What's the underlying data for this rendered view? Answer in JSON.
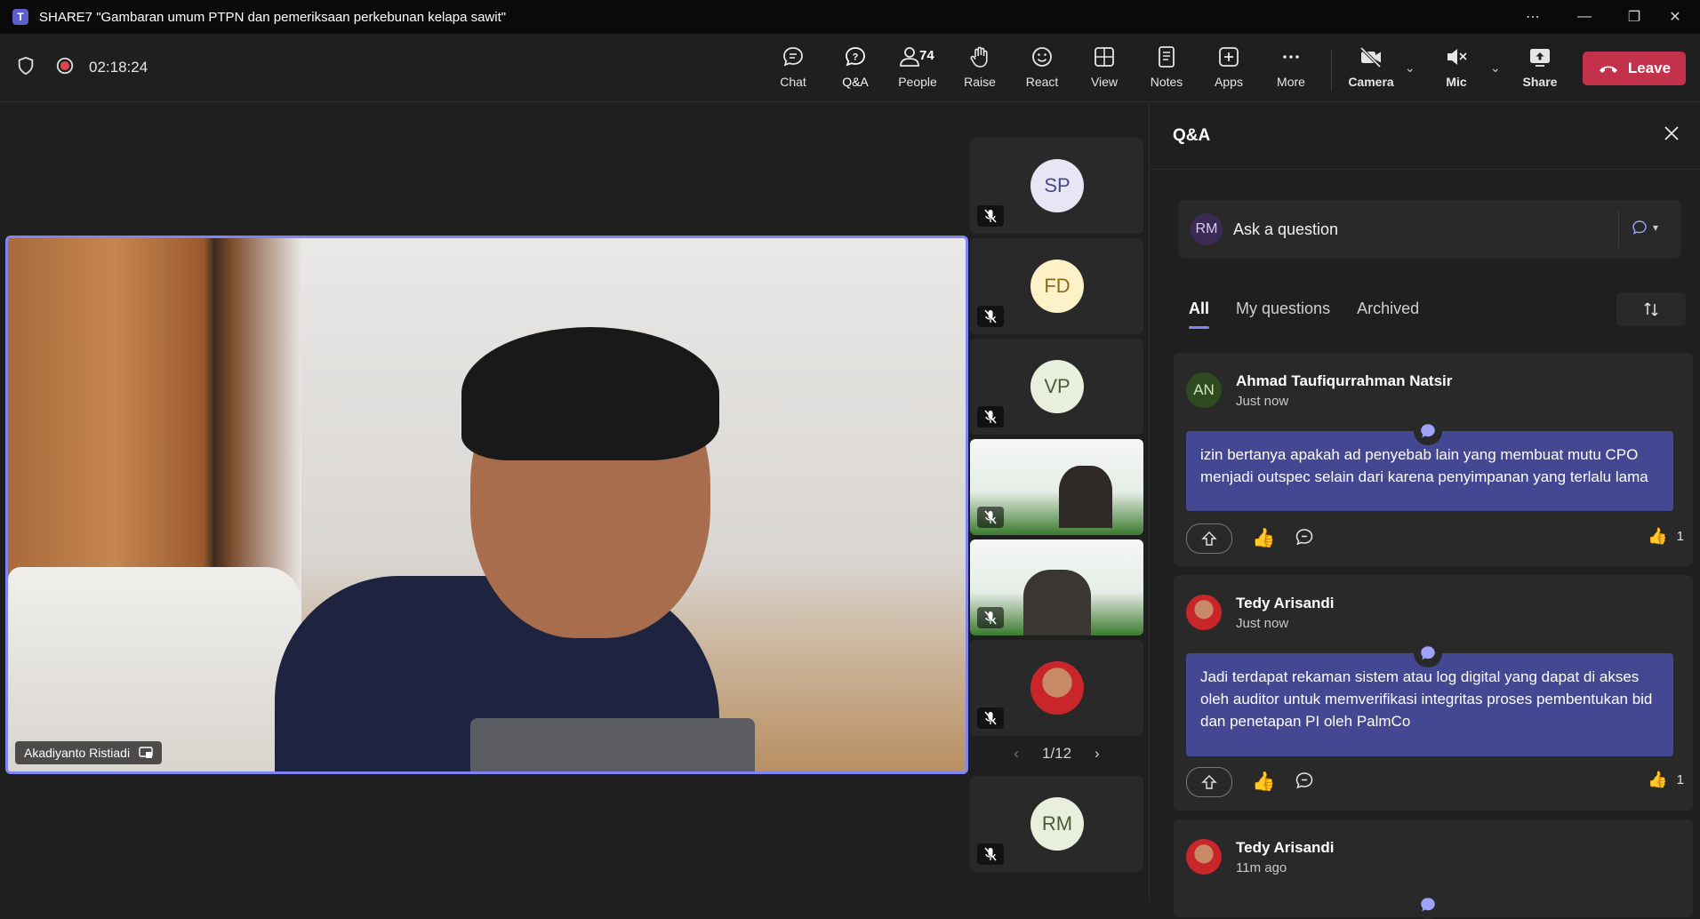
{
  "window": {
    "title": "SHARE7 \"Gambaran umum PTPN dan pemeriksaan perkebunan kelapa sawit\""
  },
  "toolbar": {
    "timer": "02:18:24",
    "people_count": "74",
    "buttons": {
      "chat": "Chat",
      "qa": "Q&A",
      "people": "People",
      "raise": "Raise",
      "react": "React",
      "view": "View",
      "notes": "Notes",
      "apps": "Apps",
      "more": "More",
      "camera": "Camera",
      "mic": "Mic",
      "share": "Share"
    },
    "leave": "Leave"
  },
  "stage": {
    "main_speaker": "Akadiyanto Ristiadi",
    "tiles": [
      {
        "initials": "SP",
        "color": "#e8e6f5"
      },
      {
        "initials": "FD",
        "color": "#fdf1c7"
      },
      {
        "initials": "VP",
        "color": "#e9efdd"
      },
      {
        "initials": "",
        "type": "share"
      },
      {
        "initials": "",
        "type": "share"
      },
      {
        "initials": "",
        "type": "photo"
      }
    ],
    "pager": "1/12",
    "bottom_tile": {
      "initials": "RM",
      "color": "#e9efdd"
    }
  },
  "qa": {
    "title": "Q&A",
    "ask": {
      "initials": "RM",
      "placeholder": "Ask a question"
    },
    "tabs": [
      "All",
      "My questions",
      "Archived"
    ],
    "questions": [
      {
        "initials": "AN",
        "author": "Ahmad Taufiqurrahman Natsir",
        "time": "Just now",
        "text": "izin bertanya apakah ad penyebab lain yang membuat mutu CPO menjadi outspec selain dari karena penyimpanan yang terlalu lama",
        "likes": "1"
      },
      {
        "initials": "",
        "author": "Tedy Arisandi",
        "time": "Just now",
        "text": "Jadi terdapat rekaman sistem atau log digital yang dapat di akses oleh auditor untuk memverifikasi integritas proses pembentukan bid dan penetapan PI oleh PalmCo",
        "likes": "1"
      },
      {
        "initials": "",
        "author": "Tedy Arisandi",
        "time": "11m ago"
      }
    ]
  },
  "colors": {
    "accent": "#7f85f5",
    "bubble": "#444791",
    "leave": "#c4314b"
  }
}
